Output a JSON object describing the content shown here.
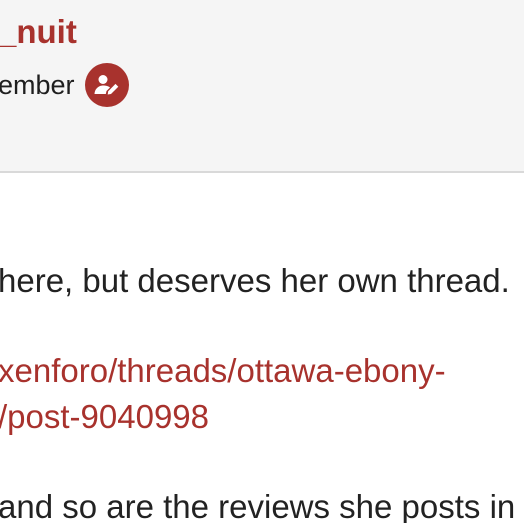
{
  "post": {
    "username": "_nuit",
    "role": "ember",
    "badge_icon": "user-pen-icon",
    "accent_color": "#a8322d"
  },
  "content": {
    "line1": "here, but deserves her own thread.",
    "link_line1": "xenforo/threads/ottawa-ebony-",
    "link_line2": "/post-9040998",
    "line4": " and so are the reviews she posts in"
  }
}
